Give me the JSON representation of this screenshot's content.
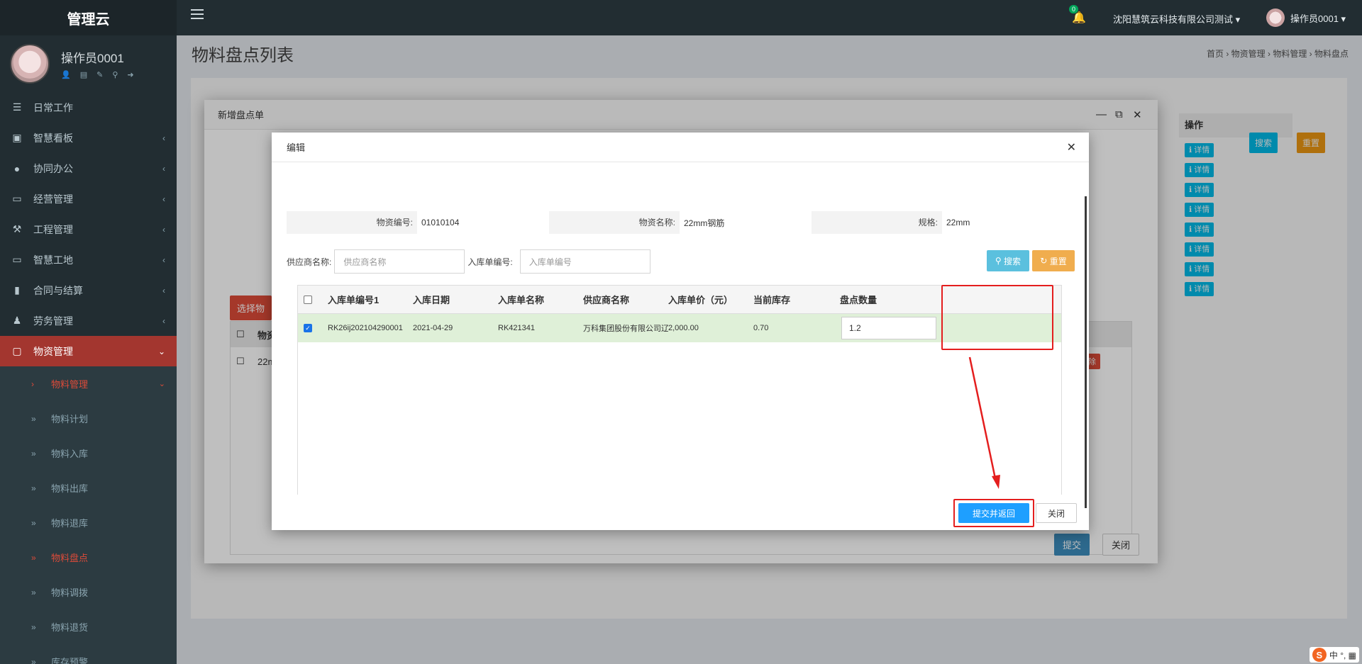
{
  "app": {
    "logo": "管理云"
  },
  "user": {
    "name": "操作员0001"
  },
  "topnav": {
    "notification_count": "0",
    "company": "沈阳慧筑云科技有限公司测试 ▾",
    "operator": "操作员0001 ▾"
  },
  "sidebar": {
    "items": [
      {
        "label": "日常工作",
        "icon": "list-icon"
      },
      {
        "label": "智慧看板",
        "icon": "dashboard-icon"
      },
      {
        "label": "协同办公",
        "icon": "users-icon"
      },
      {
        "label": "经营管理",
        "icon": "desktop-icon"
      },
      {
        "label": "工程管理",
        "icon": "hammer-icon"
      },
      {
        "label": "智慧工地",
        "icon": "desktop-icon"
      },
      {
        "label": "合同与结算",
        "icon": "file-icon"
      },
      {
        "label": "劳务管理",
        "icon": "worker-icon"
      },
      {
        "label": "物资管理",
        "icon": "cube-icon"
      }
    ],
    "sub_group": "物料管理",
    "sub_items": [
      "物料计划",
      "物料入库",
      "物料出库",
      "物料退库",
      "物料盘点",
      "物料调拨",
      "物料退货",
      "库存预警"
    ]
  },
  "page": {
    "title": "物料盘点列表",
    "breadcrumb": "首页 › 物资管理 › 物料管理 › 物料盘点"
  },
  "background": {
    "op_header": "操作",
    "detail_label": "ℹ 详情",
    "search_label": "搜索",
    "reset_label": "重置"
  },
  "outer_modal": {
    "title": "新增盘点单",
    "select_btn": "选择物",
    "col_label": "物资",
    "row_value": "22m",
    "delete_label": "除",
    "submit": "提交",
    "close": "关闭"
  },
  "inner_modal": {
    "title": "编辑",
    "material_code_label": "物资编号:",
    "material_code": "01010104",
    "material_name_label": "物资名称:",
    "material_name": "22mm钢筋",
    "spec_label": "规格:",
    "spec": "22mm",
    "supplier_label": "供应商名称:",
    "supplier_placeholder": "供应商名称",
    "receipt_label": "入库单编号:",
    "receipt_placeholder": "入库单编号",
    "search": "搜索",
    "reset": "重置",
    "columns": [
      "入库单编号1",
      "入库日期",
      "入库单名称",
      "供应商名称",
      "入库单价（元）",
      "当前库存",
      "盘点数量"
    ],
    "rows": [
      {
        "code": "RK26ij202104290001",
        "date": "2021-04-29",
        "name": "RK421341",
        "supplier": "万科集团股份有限公司辽宁",
        "price": "2,000.00",
        "stock": "0.70",
        "qty": "1.2"
      }
    ],
    "submit_return": "提交并返回",
    "close": "关闭"
  },
  "ime": {
    "label": "中 °, ▦"
  },
  "colors": {
    "sidebar": "#222d32",
    "active": "#a3362f",
    "accent_blue": "#1e9fff",
    "highlight": "#e41e1e",
    "row_selected": "#dff0d8"
  }
}
